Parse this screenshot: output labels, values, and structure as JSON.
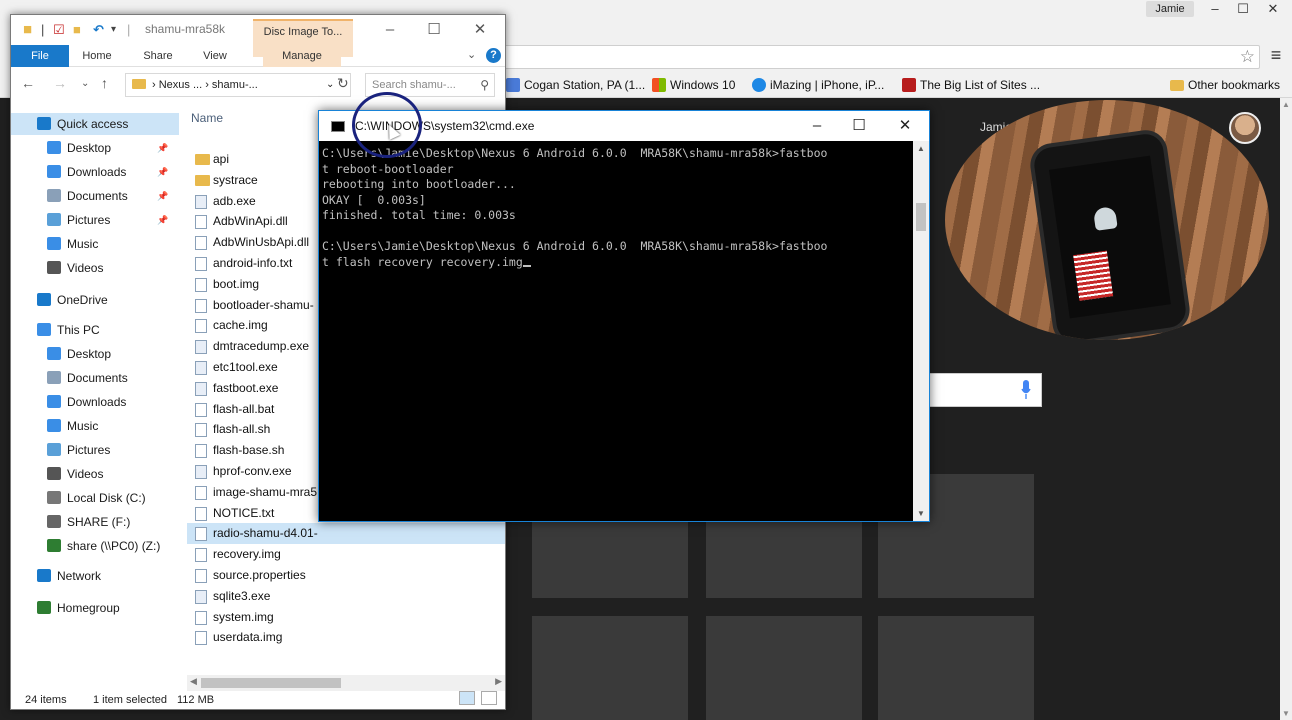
{
  "chrome": {
    "user_name": "Jamie",
    "account_label": "Jamie",
    "bookmarks": [
      {
        "label": "Cogan Station, PA (1...",
        "color": "#4a7bd8"
      },
      {
        "label": "Windows 10",
        "color": "#f25022"
      },
      {
        "label": "iMazing | iPhone, iP...",
        "color": "#1e88e5"
      },
      {
        "label": "The Big List of Sites ...",
        "color": "#b71c1c"
      }
    ],
    "other_bookmarks": "Other bookmarks"
  },
  "explorer": {
    "title": "shamu-mra58k",
    "context_tab": "Disc Image To...",
    "ribbon_tabs": [
      "File",
      "Home",
      "Share",
      "View",
      "Manage"
    ],
    "address": [
      "Nexus ...",
      "shamu-..."
    ],
    "search_placeholder": "Search shamu-...",
    "column_name": "Name",
    "nav": [
      {
        "label": "Quick access",
        "icon": "star-icon",
        "color": "#1979ca",
        "pin": false,
        "selected": true
      },
      {
        "label": "Desktop",
        "icon": "desktop-icon",
        "color": "#3a8ee6",
        "pin": true
      },
      {
        "label": "Downloads",
        "icon": "download-icon",
        "color": "#3a8ee6",
        "pin": true
      },
      {
        "label": "Documents",
        "icon": "documents-icon",
        "color": "#8aa0b8",
        "pin": true
      },
      {
        "label": "Pictures",
        "icon": "pictures-icon",
        "color": "#5aa0d8",
        "pin": true
      },
      {
        "label": "Music",
        "icon": "music-icon",
        "color": "#3a8ee6",
        "pin": false
      },
      {
        "label": "Videos",
        "icon": "videos-icon",
        "color": "#555555",
        "pin": false
      },
      {
        "label": "OneDrive",
        "icon": "onedrive-icon",
        "color": "#1979ca",
        "pin": false
      },
      {
        "label": "This PC",
        "icon": "pc-icon",
        "color": "#3a8ee6",
        "pin": false
      },
      {
        "label": "Desktop",
        "icon": "desktop-icon",
        "color": "#3a8ee6",
        "pin": false
      },
      {
        "label": "Documents",
        "icon": "documents-icon",
        "color": "#8aa0b8",
        "pin": false
      },
      {
        "label": "Downloads",
        "icon": "download-icon",
        "color": "#3a8ee6",
        "pin": false
      },
      {
        "label": "Music",
        "icon": "music-icon",
        "color": "#3a8ee6",
        "pin": false
      },
      {
        "label": "Pictures",
        "icon": "pictures-icon",
        "color": "#5aa0d8",
        "pin": false
      },
      {
        "label": "Videos",
        "icon": "videos-icon",
        "color": "#555555",
        "pin": false
      },
      {
        "label": "Local Disk (C:)",
        "icon": "disk-icon",
        "color": "#777777",
        "pin": false
      },
      {
        "label": "SHARE (F:)",
        "icon": "drive-icon",
        "color": "#666666",
        "pin": false
      },
      {
        "label": "share (\\\\PC0) (Z:)",
        "icon": "network-drive-icon",
        "color": "#2e7d32",
        "pin": false
      },
      {
        "label": "Network",
        "icon": "network-icon",
        "color": "#1979ca",
        "pin": false
      },
      {
        "label": "Homegroup",
        "icon": "homegroup-icon",
        "color": "#2e7d32",
        "pin": false
      }
    ],
    "files": [
      {
        "name": "api",
        "kind": "folder"
      },
      {
        "name": "systrace",
        "kind": "folder"
      },
      {
        "name": "adb.exe",
        "kind": "exe"
      },
      {
        "name": "AdbWinApi.dll",
        "kind": "file"
      },
      {
        "name": "AdbWinUsbApi.dll",
        "kind": "file"
      },
      {
        "name": "android-info.txt",
        "kind": "file"
      },
      {
        "name": "boot.img",
        "kind": "file"
      },
      {
        "name": "bootloader-shamu-",
        "kind": "file"
      },
      {
        "name": "cache.img",
        "kind": "file"
      },
      {
        "name": "dmtracedump.exe",
        "kind": "exe"
      },
      {
        "name": "etc1tool.exe",
        "kind": "exe"
      },
      {
        "name": "fastboot.exe",
        "kind": "exe"
      },
      {
        "name": "flash-all.bat",
        "kind": "file"
      },
      {
        "name": "flash-all.sh",
        "kind": "file"
      },
      {
        "name": "flash-base.sh",
        "kind": "file"
      },
      {
        "name": "hprof-conv.exe",
        "kind": "exe"
      },
      {
        "name": "image-shamu-mra5",
        "kind": "file"
      },
      {
        "name": "NOTICE.txt",
        "kind": "file"
      },
      {
        "name": "radio-shamu-d4.01-",
        "kind": "file"
      },
      {
        "name": "recovery.img",
        "kind": "file"
      },
      {
        "name": "source.properties",
        "kind": "file"
      },
      {
        "name": "sqlite3.exe",
        "kind": "exe"
      },
      {
        "name": "system.img",
        "kind": "file"
      },
      {
        "name": "userdata.img",
        "kind": "file"
      }
    ],
    "selected_file": "radio-shamu-d4.01-",
    "status": {
      "items": "24 items",
      "selected": "1 item selected",
      "size": "112 MB"
    }
  },
  "cmd": {
    "title": "C:\\WINDOWS\\system32\\cmd.exe",
    "lines": [
      "C:\\Users\\Jamie\\Desktop\\Nexus 6 Android 6.0.0  MRA58K\\shamu-mra58k>fastboo",
      "t reboot-bootloader",
      "rebooting into bootloader...",
      "OKAY [  0.003s]",
      "finished. total time: 0.003s",
      "",
      "C:\\Users\\Jamie\\Desktop\\Nexus 6 Android 6.0.0  MRA58K\\shamu-mra58k>fastboo",
      "t flash recovery recovery.img"
    ]
  }
}
